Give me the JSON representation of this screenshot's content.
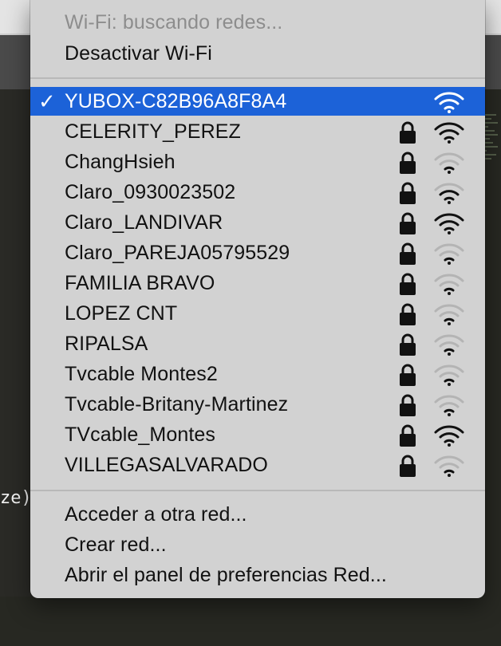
{
  "background": {
    "editor_fragment": "ze)"
  },
  "wifi_menu": {
    "status": "Wi-Fi: buscando redes...",
    "toggle_label": "Desactivar Wi-Fi",
    "connected_network": {
      "name": "YUBOX-C82B96A8F8A4",
      "checkmark": "✓",
      "signal_icon": "wifi-signal-icon"
    },
    "networks": [
      {
        "name": "CELERITY_PEREZ",
        "locked": true,
        "signal": "full"
      },
      {
        "name": "ChangHsieh",
        "locked": true,
        "signal": "weak"
      },
      {
        "name": "Claro_0930023502",
        "locked": true,
        "signal": "medium"
      },
      {
        "name": "Claro_LANDIVAR",
        "locked": true,
        "signal": "full"
      },
      {
        "name": "Claro_PAREJA05795529",
        "locked": true,
        "signal": "weak"
      },
      {
        "name": "FAMILIA BRAVO",
        "locked": true,
        "signal": "weak"
      },
      {
        "name": "LOPEZ CNT",
        "locked": true,
        "signal": "weak"
      },
      {
        "name": "RIPALSA",
        "locked": true,
        "signal": "weak"
      },
      {
        "name": "Tvcable Montes2",
        "locked": true,
        "signal": "weak"
      },
      {
        "name": "Tvcable-Britany-Martinez",
        "locked": true,
        "signal": "weak"
      },
      {
        "name": "TVcable_Montes",
        "locked": true,
        "signal": "full"
      },
      {
        "name": "VILLEGASALVARADO",
        "locked": true,
        "signal": "weak"
      }
    ],
    "actions": {
      "join_other": "Acceder a otra red...",
      "create_network": "Crear red...",
      "open_preferences": "Abrir el panel de preferencias Red..."
    },
    "colors": {
      "menu_background": "#d2d2d2",
      "selection": "#1c62d8",
      "disabled_text": "#8d8d8d",
      "icon_active": "#111111",
      "icon_inactive": "#b4b4b4"
    }
  }
}
